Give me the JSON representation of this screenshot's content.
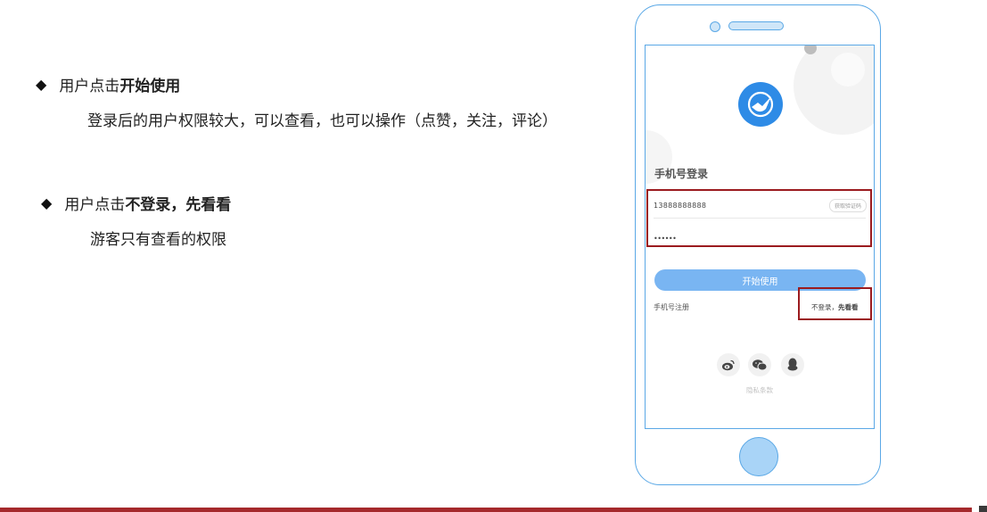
{
  "notes": [
    {
      "prefix": "用户点击",
      "action": "开始使用",
      "description": "登录后的用户权限较大，可以查看，也可以操作（点赞，关注，评论）"
    },
    {
      "prefix": "用户点击",
      "action": "不登录，先看看",
      "description": "游客只有查看的权限"
    }
  ],
  "bullet_icon": "diamond-icon",
  "phone": {
    "login_title": "手机号登录",
    "phone_value": "13888888888",
    "get_code_label": "获取验证码",
    "password_value": "••••••",
    "start_button": "开始使用",
    "register_link": "手机号注册",
    "skip_prefix": "不登录，",
    "skip_strong": "先看看",
    "social_icons": [
      "weibo-icon",
      "wechat-icon",
      "qq-icon"
    ],
    "privacy_label": "隐私条款"
  },
  "colors": {
    "accent": "#2e8be6",
    "button": "#79b5f2",
    "phone_outline": "#5aa8e6",
    "highlight": "#9b1b1f",
    "footer": "#a5292c"
  }
}
